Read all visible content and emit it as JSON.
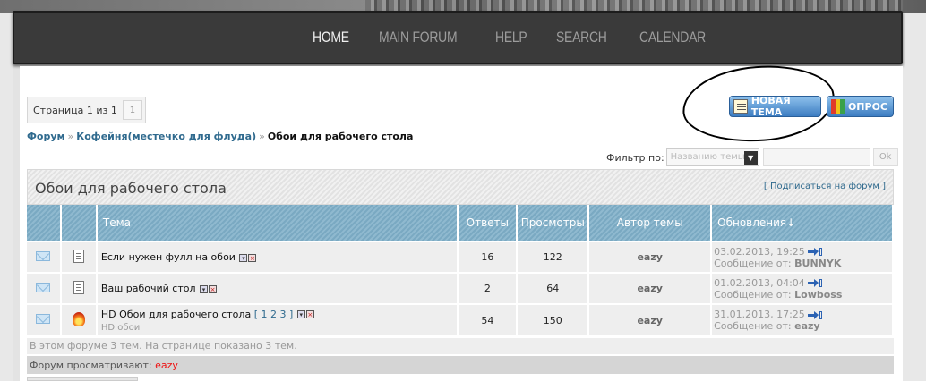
{
  "nav": {
    "items": [
      {
        "label": "HOME",
        "active": true
      },
      {
        "label": "MAIN FORUM",
        "active": false
      },
      {
        "label": "HELP",
        "active": false
      },
      {
        "label": "SEARCH",
        "active": false
      },
      {
        "label": "CALENDAR",
        "active": false
      }
    ]
  },
  "pager": {
    "text": "Страница 1 из 1",
    "page": "1"
  },
  "buttons": {
    "new_topic": "НОВАЯ ТЕМА",
    "poll": "ОПРОС"
  },
  "breadcrumb": {
    "root": "Форум",
    "sep": "»",
    "parent": "Кофейня(местечко для флуда)",
    "current": "Обои для рабочего стола"
  },
  "filter": {
    "label": "Фильтр по:",
    "selected": "Названию темы",
    "ok": "Ok"
  },
  "forum": {
    "title": "Обои для рабочего стола",
    "subscribe": "[ Подписаться на форум ]"
  },
  "table": {
    "headers": {
      "topic": "Тема",
      "replies": "Ответы",
      "views": "Просмотры",
      "author": "Автор темы",
      "updated": "Обновления↓"
    },
    "rows": [
      {
        "title": "Если нужен фулл на обои",
        "pages": "",
        "description": "",
        "replies": "16",
        "views": "122",
        "author": "eazy",
        "last_date": "03.02.2013, 19:25",
        "last_prefix": "Сообщение от:",
        "last_user": "BUNNYK",
        "hot": false
      },
      {
        "title": "Ваш рабочий стол",
        "pages": "",
        "description": "",
        "replies": "2",
        "views": "64",
        "author": "eazy",
        "last_date": "01.02.2013, 04:04",
        "last_prefix": "Сообщение от:",
        "last_user": "Lowboss",
        "hot": false
      },
      {
        "title": "HD Обои для рабочего стола",
        "pages": "[ 1 2 3 ]",
        "description": "HD обои",
        "replies": "54",
        "views": "150",
        "author": "eazy",
        "last_date": "31.01.2013, 17:25",
        "last_prefix": "Сообщение от:",
        "last_user": "eazy",
        "hot": true
      }
    ]
  },
  "stats": "В этом форуме 3 тем. На странице показано 3 тем.",
  "viewers": {
    "label": "Форум просматривают:",
    "name": "eazy"
  }
}
